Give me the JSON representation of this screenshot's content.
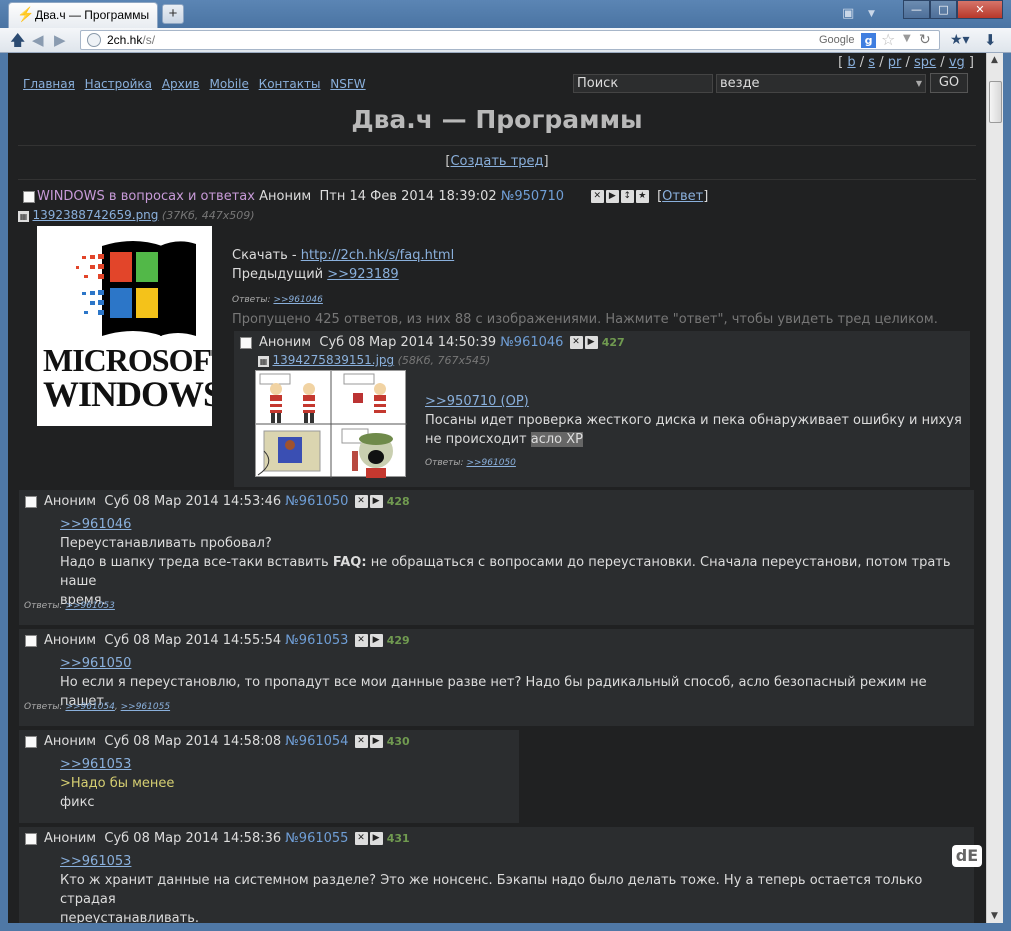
{
  "browser": {
    "tab_title": "Два.ч — Программы",
    "new_tab": "+",
    "url_host": "2ch.hk",
    "url_path": "/s/",
    "search_engine": "Google",
    "window_buttons": [
      "—",
      "□",
      "✕"
    ]
  },
  "page": {
    "boards": {
      "open": "[",
      "items": [
        "b",
        "s",
        "pr",
        "spc",
        "vg"
      ],
      "close": "]"
    },
    "nav": [
      "Главная",
      "Настройка",
      "Архив",
      "Mobile",
      "Контакты",
      "NSFW"
    ],
    "search_placeholder": "Поиск",
    "search_scope": "везде",
    "search_button": "GO",
    "title": "Два.ч — Программы",
    "create_thread": "Создать тред"
  },
  "op": {
    "subject": "WINDOWS в вопросах и ответах",
    "author": "Аноним",
    "date": "Птн 14 Фев 2014 18:39:02",
    "num": "№950710",
    "reply_link": "Ответ",
    "file_name": "1392388742659.png",
    "file_info": "(37Кб, 447x509)",
    "download_label": "Скачать - ",
    "download_link": "http://2ch.hk/s/faq.html",
    "prev_label": "Предыдущий ",
    "prev_link": ">>923189",
    "replies_label": "Ответы:",
    "replies": [
      ">>961046"
    ],
    "omitted": "Пропущено 425 ответов, из них 88 с изображениями. Нажмите \"ответ\", чтобы увидеть тред целиком.",
    "logo_line1": "MICROSOFT.",
    "logo_line2": "WINDOWS."
  },
  "posts": [
    {
      "author": "Аноним",
      "date": "Суб 08 Мар 2014 14:50:39",
      "num": "№961046",
      "index": "427",
      "file_name": "1394275839151.jpg",
      "file_info": "(58Кб, 767x545)",
      "link": ">>950710 (OP)",
      "text1": "Посаны идет проверка жесткого диска и пека обнаруживает ошибку и нихуя",
      "text2_a": "не происходит ",
      "text2_hl": "асло XP",
      "replies": [
        ">>961050"
      ]
    },
    {
      "author": "Аноним",
      "date": "Суб 08 Мар 2014 14:53:46",
      "num": "№961050",
      "index": "428",
      "link": ">>961046",
      "line1": "Переустанавливать пробовал?",
      "line2_a": "Надо в шапку треда все-таки вставить ",
      "line2_b": "FAQ:",
      "line2_c": " не обращаться с вопросами до переустановки. Сначала переустанови, потом трать наше",
      "line3": "время.",
      "replies": [
        ">>961053"
      ]
    },
    {
      "author": "Аноним",
      "date": "Суб 08 Мар 2014 14:55:54",
      "num": "№961053",
      "index": "429",
      "link": ">>961050",
      "line1": "Но если я переустановлю, то пропадут все мои данные разве нет? Надо бы радикальный способ, асло безопасный режим не пашет.",
      "replies": [
        ">>961054",
        ">>961055"
      ]
    },
    {
      "author": "Аноним",
      "date": "Суб 08 Мар 2014 14:58:08",
      "num": "№961054",
      "index": "430",
      "link": ">>961053",
      "quote": ">Надо бы менее",
      "line1": "фикс"
    },
    {
      "author": "Аноним",
      "date": "Суб 08 Мар 2014 14:58:36",
      "num": "№961055",
      "index": "431",
      "link": ">>961053",
      "line1": "Кто ж хранит данные на системном разделе? Это же нонсенс. Бэкапы надо было делать тоже. Ну а теперь остается только страдая",
      "line2": "переустанавливать."
    }
  ],
  "colors": {
    "background": "#202122",
    "post_bg": "#2b2d2f",
    "link": "#8ab0dc",
    "subject": "#c79ad8",
    "greentext": "#d6cf72",
    "index": "#709a50"
  }
}
